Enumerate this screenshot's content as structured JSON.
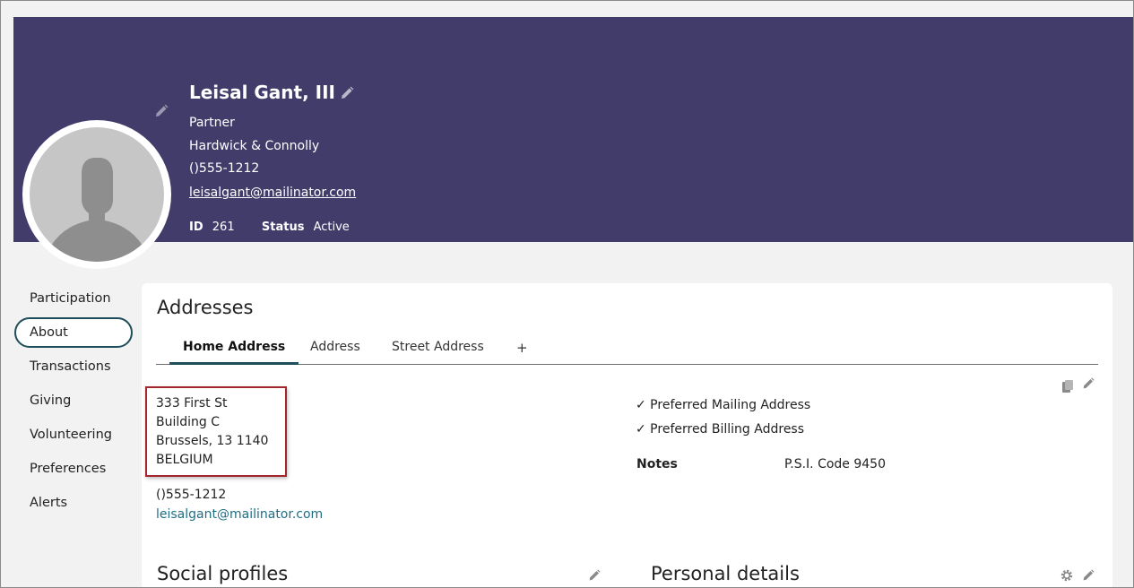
{
  "profile": {
    "name": "Leisal Gant, III",
    "title": "Partner",
    "organization": "Hardwick & Connolly",
    "phone": "()555-1212",
    "email": "leisalgant@mailinator.com",
    "id_label": "ID",
    "id_value": "261",
    "status_label": "Status",
    "status_value": "Active"
  },
  "sidebar": {
    "items": [
      {
        "label": "Participation",
        "active": false
      },
      {
        "label": "About",
        "active": true
      },
      {
        "label": "Transactions",
        "active": false
      },
      {
        "label": "Giving",
        "active": false
      },
      {
        "label": "Volunteering",
        "active": false
      },
      {
        "label": "Preferences",
        "active": false
      },
      {
        "label": "Alerts",
        "active": false
      }
    ]
  },
  "addresses": {
    "title": "Addresses",
    "tabs": [
      "Home Address",
      "Address",
      "Street Address"
    ],
    "add_tab": "+",
    "lines": [
      "333 First St",
      "Building C",
      "Brussels, 13 1140",
      "BELGIUM"
    ],
    "phone": "()555-1212",
    "email": "leisalgant@mailinator.com",
    "preferred_mailing": "✓ Preferred Mailing Address",
    "preferred_billing": "✓ Preferred Billing Address",
    "notes_label": "Notes",
    "notes_value": "P.S.I. Code 9450"
  },
  "sections": {
    "social_profiles": "Social profiles",
    "personal_details": "Personal details"
  },
  "icons": {
    "pencil": "pencil-icon",
    "copy": "copy-icon",
    "gear": "gear-icon"
  },
  "colors": {
    "banner": "#423c6b",
    "accent": "#1d4e5a",
    "link": "#1f6d84",
    "highlight_box": "#a3262d"
  }
}
